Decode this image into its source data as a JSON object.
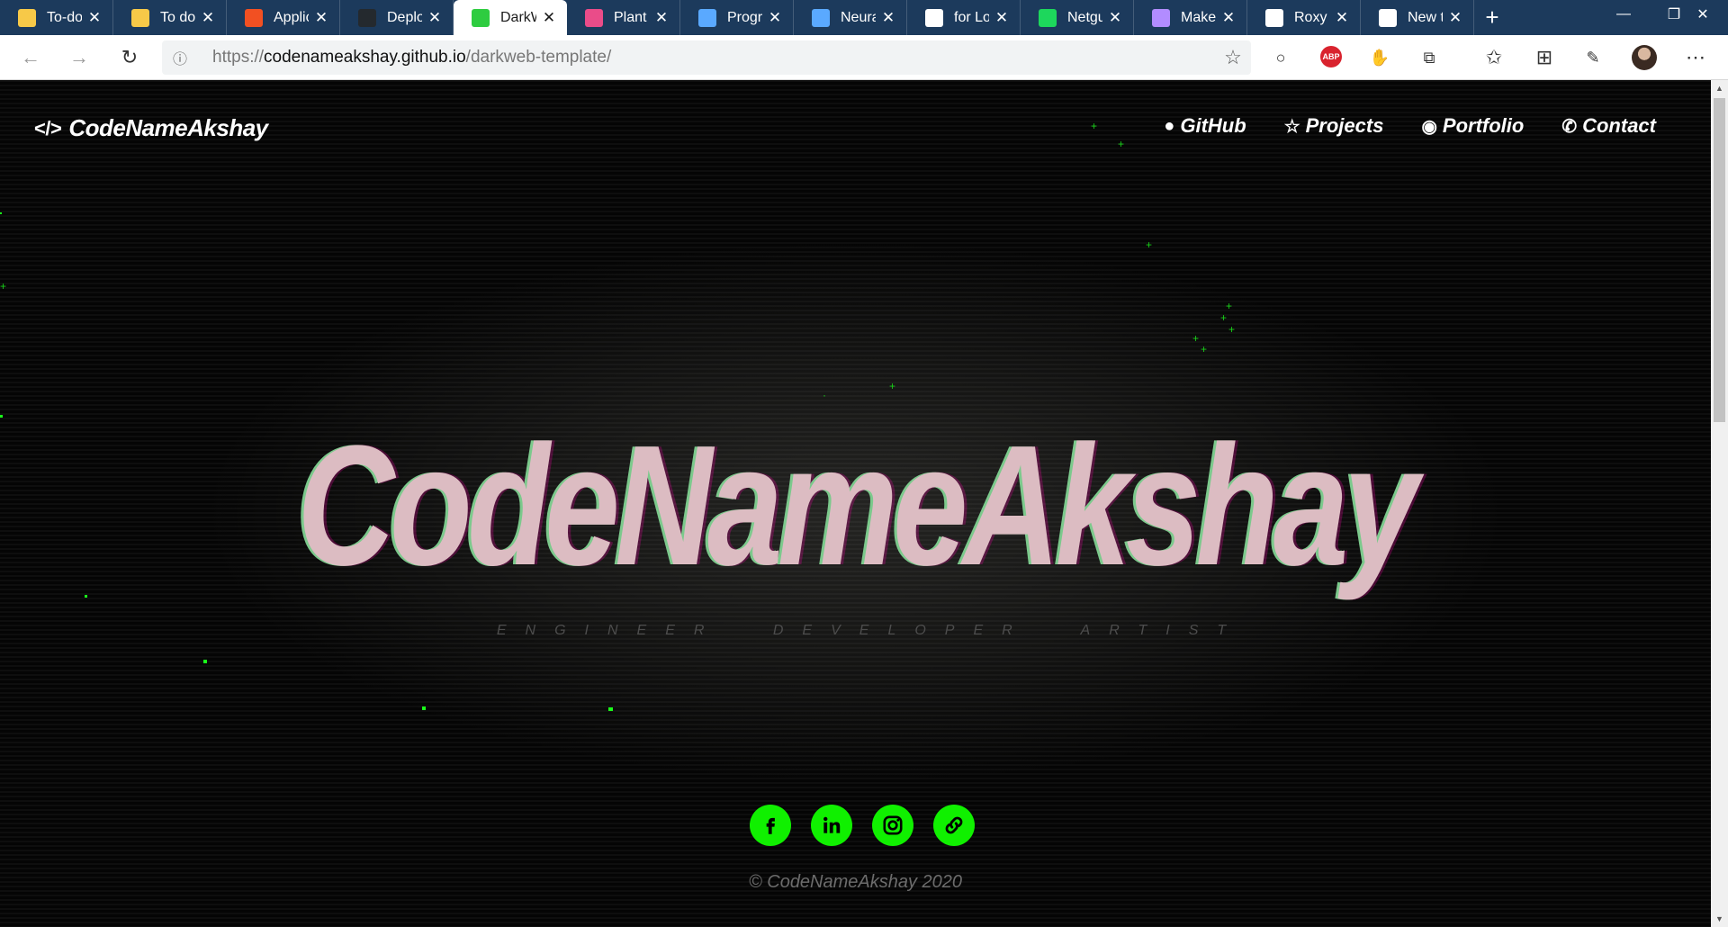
{
  "browser": {
    "tabs": [
      {
        "title": "To-do",
        "icon": "todo-icon",
        "color": "#f7c948",
        "active": false
      },
      {
        "title": "To do",
        "icon": "todo-icon",
        "color": "#f7c948",
        "active": false
      },
      {
        "title": "Applic",
        "icon": "microsoft-icon",
        "color": "#f25022",
        "active": false
      },
      {
        "title": "Deploy",
        "icon": "github-icon",
        "color": "#24292e",
        "active": false
      },
      {
        "title": "DarkW",
        "icon": "darkweb-icon",
        "color": "#2ecc40",
        "active": true
      },
      {
        "title": "Plant S",
        "icon": "dribbble-icon",
        "color": "#ea4c89",
        "active": false
      },
      {
        "title": "Progra",
        "icon": "infinity-icon",
        "color": "#5aa9ff",
        "active": false
      },
      {
        "title": "Neural",
        "icon": "infinity-icon",
        "color": "#5aa9ff",
        "active": false
      },
      {
        "title": "for Loc",
        "icon": "terminal-icon",
        "color": "#ffffff",
        "active": false
      },
      {
        "title": "Netgu",
        "icon": "netguru-icon",
        "color": "#1dd75c",
        "active": false
      },
      {
        "title": "Make I",
        "icon": "image-icon",
        "color": "#b28cff",
        "active": false
      },
      {
        "title": "Roxy K",
        "icon": "r-icon",
        "color": "#ffffff",
        "active": false
      },
      {
        "title": "New ta",
        "icon": "newtab-icon",
        "color": "#ffffff",
        "active": false
      }
    ],
    "close_glyph": "✕",
    "new_tab_glyph": "+",
    "url": {
      "scheme": "https://",
      "host": "codenameakshay.github.io",
      "path": "/darkweb-template/"
    }
  },
  "page": {
    "brand": {
      "icon_text": "</>",
      "name": "CodeNameAkshay"
    },
    "nav": [
      {
        "label": "GitHub",
        "icon": "github-icon",
        "glyph": "●"
      },
      {
        "label": "Projects",
        "icon": "star-icon",
        "glyph": "☆"
      },
      {
        "label": "Portfolio",
        "icon": "user-circle-icon",
        "glyph": "◉"
      },
      {
        "label": "Contact",
        "icon": "phone-icon",
        "glyph": "✆"
      }
    ],
    "hero_title": "CodeNameAkshay",
    "hero_subtitle": "ENGINEER DEVELOPER ARTIST",
    "socials": [
      {
        "name": "facebook",
        "icon": "facebook-icon"
      },
      {
        "name": "linkedin",
        "icon": "linkedin-icon"
      },
      {
        "name": "instagram",
        "icon": "instagram-icon"
      },
      {
        "name": "link",
        "icon": "link-icon"
      }
    ],
    "footer": "© CodeNameAkshay 2020",
    "accent_color": "#10f000"
  }
}
